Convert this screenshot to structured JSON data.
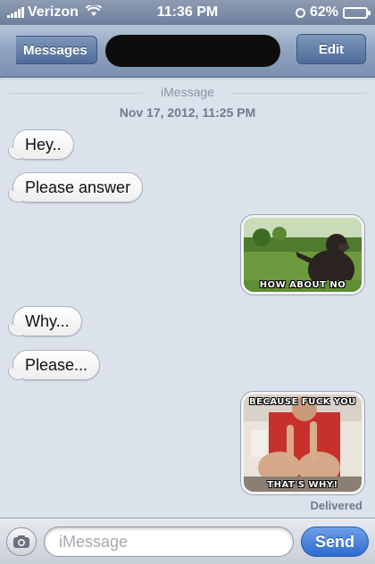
{
  "status_bar": {
    "carrier": "Verizon",
    "time": "11:36 PM",
    "battery_percent": "62%",
    "battery_level": 0.62,
    "icons": [
      "signal-bars",
      "wifi",
      "alarm-clock",
      "battery"
    ]
  },
  "nav_bar": {
    "back_label": "Messages",
    "title_redacted": true,
    "edit_label": "Edit"
  },
  "conversation": {
    "service_label": "iMessage",
    "timestamp": "Nov 17, 2012, 11:25 PM",
    "messages": [
      {
        "from": "received",
        "type": "text",
        "text": "Hey.."
      },
      {
        "from": "received",
        "type": "text",
        "text": "Please answer"
      },
      {
        "from": "sent",
        "type": "image",
        "caption_top": "",
        "caption_bottom": "HOW ABOUT NO"
      },
      {
        "from": "received",
        "type": "text",
        "text": "Why..."
      },
      {
        "from": "received",
        "type": "text",
        "text": "Please..."
      },
      {
        "from": "sent",
        "type": "image",
        "caption_top": "BECAUSE FUCK YOU",
        "caption_bottom": "THAT'S WHY!"
      }
    ],
    "delivery_status": "Delivered"
  },
  "input_bar": {
    "placeholder": "iMessage",
    "value": "",
    "send_label": "Send"
  },
  "colors": {
    "nav_accent": "#5b77a3",
    "send_blue": "#2f6cd0",
    "conversation_bg": "#dbe2ec"
  }
}
